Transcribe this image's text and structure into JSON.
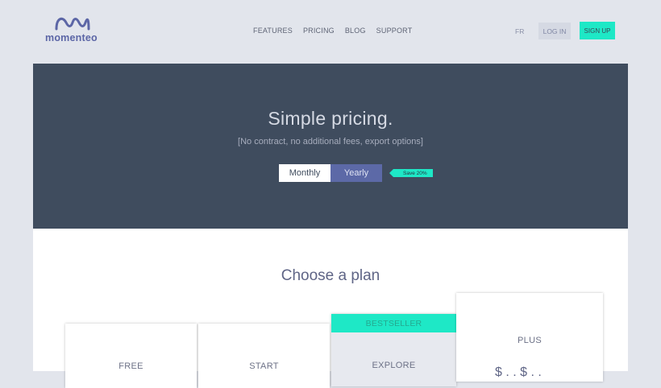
{
  "brand": {
    "name": "momenteo"
  },
  "nav": {
    "items": [
      {
        "label": "FEATURES"
      },
      {
        "label": "PRICING"
      },
      {
        "label": "BLOG"
      },
      {
        "label": "SUPPORT"
      }
    ],
    "lang": "FR",
    "login": "LOG IN",
    "signup": "SIGN UP"
  },
  "hero": {
    "title": "Simple pricing.",
    "subtitle": "[No contract, no additional fees, export options]",
    "toggle": {
      "monthly": "Monthly",
      "yearly": "Yearly",
      "selected": "Yearly"
    },
    "save_badge": "Save 20%"
  },
  "plans": {
    "title": "Choose a plan",
    "cards": [
      {
        "name": "FREE"
      },
      {
        "name": "START"
      },
      {
        "name": "EXPLORE",
        "badge": "BESTSELLER"
      },
      {
        "name": "PLUS",
        "price_peek": "$ . . $ . ."
      }
    ]
  },
  "colors": {
    "accent": "#1ee8c6",
    "brand": "#5c66a6",
    "hero_bg": "#3f4c5e",
    "page_bg": "#e2e5ec"
  }
}
